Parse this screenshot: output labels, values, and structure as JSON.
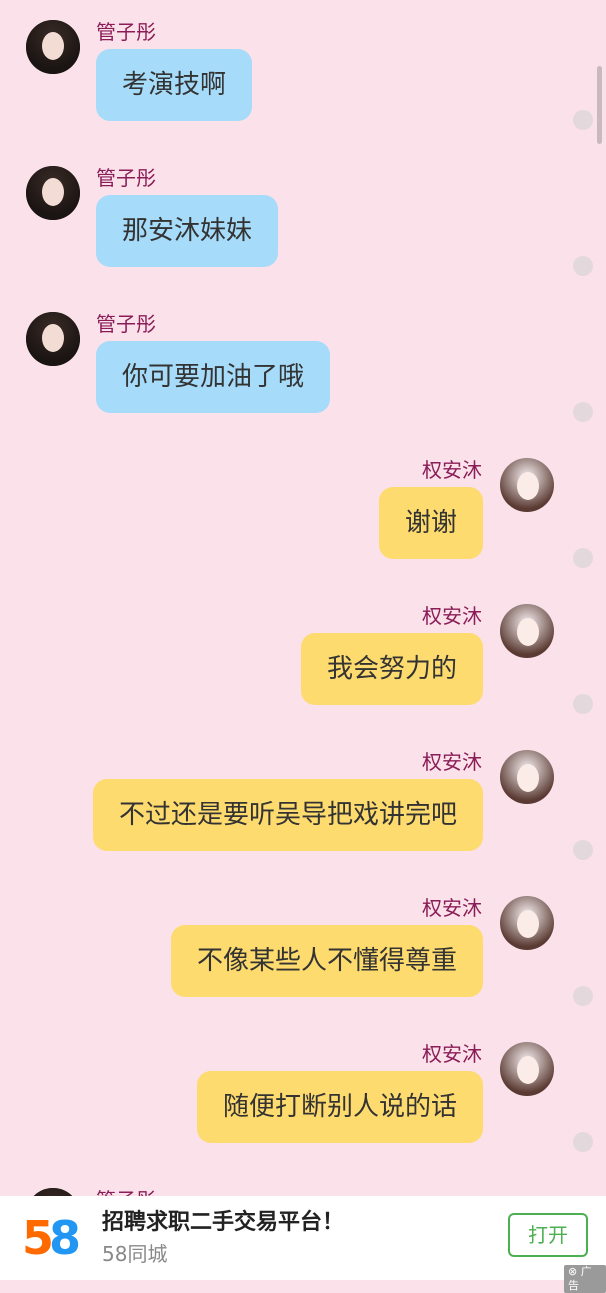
{
  "messages": [
    {
      "side": "left",
      "sender": "管子彤",
      "text": "考演技啊"
    },
    {
      "side": "left",
      "sender": "管子彤",
      "text": "那安沐妹妹"
    },
    {
      "side": "left",
      "sender": "管子彤",
      "text": "你可要加油了哦"
    },
    {
      "side": "right",
      "sender": "权安沐",
      "text": "谢谢"
    },
    {
      "side": "right",
      "sender": "权安沐",
      "text": "我会努力的"
    },
    {
      "side": "right",
      "sender": "权安沐",
      "text": "不过还是要听吴导把戏讲完吧"
    },
    {
      "side": "right",
      "sender": "权安沐",
      "text": "不像某些人不懂得尊重"
    },
    {
      "side": "right",
      "sender": "权安沐",
      "text": "随便打断别人说的话"
    },
    {
      "side": "left",
      "sender": "管子彤",
      "text": ""
    }
  ],
  "ad": {
    "logo_digit_1": "5",
    "logo_digit_2": "8",
    "title": "招聘求职二手交易平台！",
    "subtitle": "58同城",
    "button": "打开",
    "label": "广告"
  },
  "colors": {
    "background": "#fbe1ea",
    "left_bubble": "#a6dcfa",
    "right_bubble": "#fedb6e",
    "sender_name": "#8a1d57",
    "ad_button": "#4caf50"
  }
}
